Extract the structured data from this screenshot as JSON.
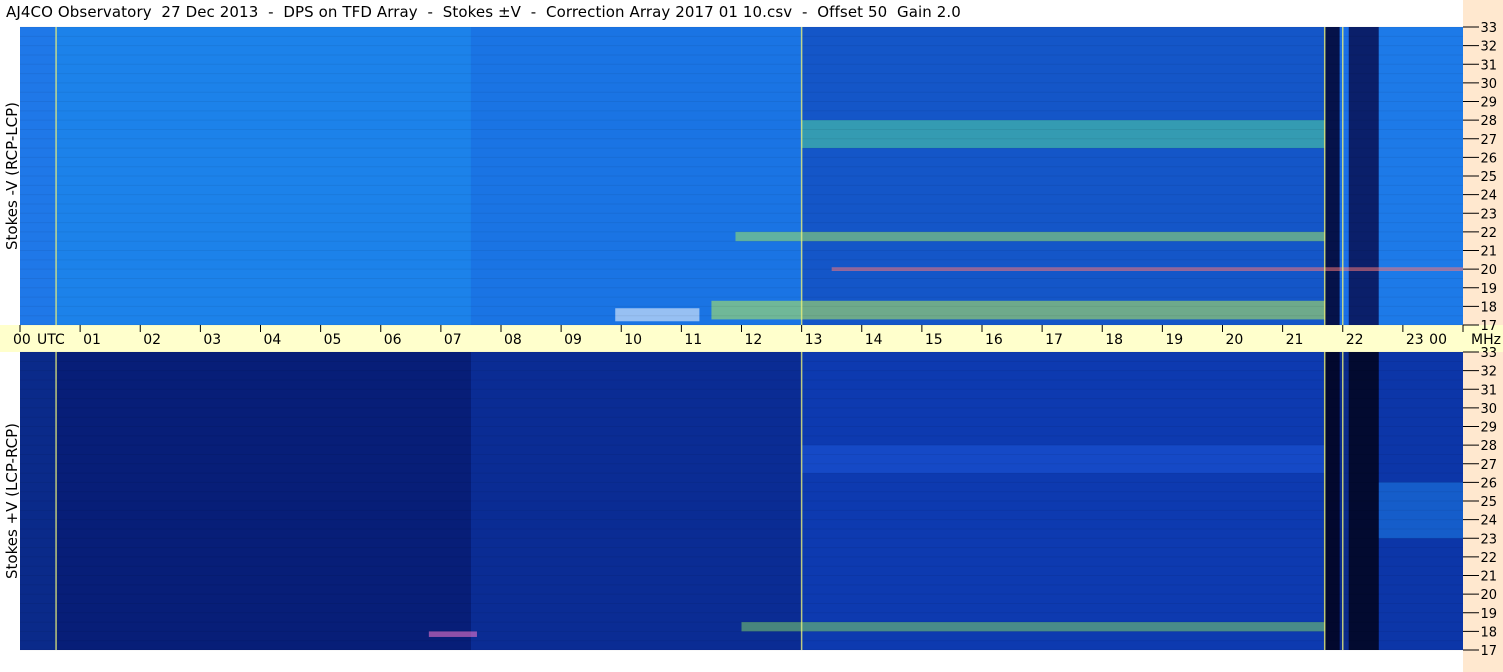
{
  "title": "AJ4CO Observatory  27 Dec 2013  -  DPS on TFD Array  -  Stokes ±V  -  Correction Array 2017 01 10.csv  -  Offset 50  Gain 2.0",
  "panels": {
    "top_ylabel": "Stokes -V (RCP-LCP)",
    "bottom_ylabel": "Stokes +V (LCP-RCP)"
  },
  "colors": {
    "time_axis_bg": "#ffffcc",
    "freq_strip_bg": "#ffe8cf",
    "marker_line": "#e8f07a"
  },
  "chart_data": {
    "type": "heatmap",
    "x_axis": {
      "unit_label": "UTC",
      "ticks": [
        "00",
        "01",
        "02",
        "03",
        "04",
        "05",
        "06",
        "07",
        "08",
        "09",
        "10",
        "11",
        "12",
        "13",
        "14",
        "15",
        "16",
        "17",
        "18",
        "19",
        "20",
        "21",
        "22",
        "23",
        "00"
      ],
      "xlim": [
        0,
        24
      ]
    },
    "y_axis": {
      "unit_label": "MHz",
      "ticks": [
        "17",
        "18",
        "19",
        "20",
        "21",
        "22",
        "23",
        "24",
        "25",
        "26",
        "27",
        "28",
        "29",
        "30",
        "31",
        "32",
        "33"
      ],
      "ylim": [
        17,
        33
      ]
    },
    "panels": [
      {
        "name": "Stokes -V (RCP-LCP)",
        "base_color": "#1a6ee6",
        "bands": [
          {
            "t0": 0.0,
            "t1": 0.6,
            "color": "#1f78e8"
          },
          {
            "t0": 0.6,
            "t1": 7.5,
            "color": "#1c82ea"
          },
          {
            "t0": 7.5,
            "t1": 13.0,
            "color": "#1a74e4"
          },
          {
            "t0": 13.0,
            "t1": 21.7,
            "color": "#1456c8"
          },
          {
            "t0": 21.7,
            "t1": 21.95,
            "color": "#05124a"
          },
          {
            "t0": 21.95,
            "t1": 22.1,
            "color": "#1a6ee6"
          },
          {
            "t0": 22.1,
            "t1": 22.6,
            "color": "#0a1f6a"
          },
          {
            "t0": 22.6,
            "t1": 24.0,
            "color": "#1d7ae8"
          }
        ],
        "activity": [
          {
            "t0": 13.0,
            "t1": 21.7,
            "f0": 26.5,
            "f1": 28.0,
            "color": "#4fd6a0"
          },
          {
            "t0": 11.9,
            "t1": 21.7,
            "f0": 21.5,
            "f1": 22.0,
            "color": "#9ae66a"
          },
          {
            "t0": 13.5,
            "t1": 24.0,
            "f0": 19.9,
            "f1": 20.1,
            "color": "#ff7a7a"
          },
          {
            "t0": 9.9,
            "t1": 11.3,
            "f0": 17.2,
            "f1": 17.9,
            "color": "#ffffff"
          },
          {
            "t0": 11.5,
            "t1": 21.7,
            "f0": 17.3,
            "f1": 18.3,
            "color": "#b8f05a"
          }
        ]
      },
      {
        "name": "Stokes +V (LCP-RCP)",
        "base_color": "#06186a",
        "bands": [
          {
            "t0": 0.0,
            "t1": 0.6,
            "color": "#0a2a8a"
          },
          {
            "t0": 0.6,
            "t1": 7.5,
            "color": "#071e78"
          },
          {
            "t0": 7.5,
            "t1": 13.0,
            "color": "#0a2c94"
          },
          {
            "t0": 13.0,
            "t1": 21.7,
            "color": "#0d3ab0"
          },
          {
            "t0": 21.7,
            "t1": 21.95,
            "color": "#02082e"
          },
          {
            "t0": 21.95,
            "t1": 22.1,
            "color": "#0a2a8a"
          },
          {
            "t0": 22.1,
            "t1": 22.6,
            "color": "#020a30"
          },
          {
            "t0": 22.6,
            "t1": 24.0,
            "color": "#0c36a8"
          }
        ],
        "activity": [
          {
            "t0": 13.0,
            "t1": 21.7,
            "f0": 26.5,
            "f1": 28.0,
            "color": "#1d56d8"
          },
          {
            "t0": 12.0,
            "t1": 21.7,
            "f0": 18.0,
            "f1": 18.5,
            "color": "#7ccf6a"
          },
          {
            "t0": 6.8,
            "t1": 7.6,
            "f0": 17.7,
            "f1": 18.0,
            "color": "#ff7ad2"
          },
          {
            "t0": 22.6,
            "t1": 24.0,
            "f0": 23.0,
            "f1": 26.0,
            "color": "#1e7ee6"
          }
        ]
      }
    ]
  }
}
